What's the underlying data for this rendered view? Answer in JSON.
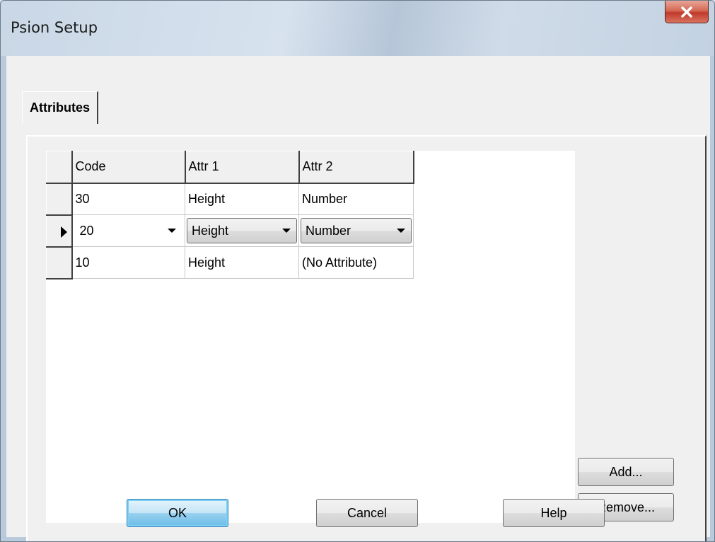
{
  "window": {
    "title": "Psion Setup",
    "close_label": "Close"
  },
  "tabs": [
    {
      "label": "Attributes",
      "active": true
    }
  ],
  "grid": {
    "columns": [
      "Code",
      "Attr 1",
      "Attr 2"
    ],
    "rows": [
      {
        "code": "30",
        "attr1": "Height",
        "attr2": "Number",
        "current": false
      },
      {
        "code": "20",
        "attr1": "Height",
        "attr2": "Number",
        "current": true
      },
      {
        "code": "10",
        "attr1": "Height",
        "attr2": "(No Attribute)",
        "current": false
      }
    ]
  },
  "side_buttons": {
    "add": "Add...",
    "remove": "Remove..."
  },
  "footer_buttons": {
    "ok": "OK",
    "cancel": "Cancel",
    "help": "Help"
  },
  "icons": {
    "close": "close-x-icon",
    "current_row": "row-pointer-icon",
    "dropdown": "chevron-down-icon"
  },
  "colors": {
    "close_button": "#c0392b",
    "default_button": "#6cbde8"
  }
}
